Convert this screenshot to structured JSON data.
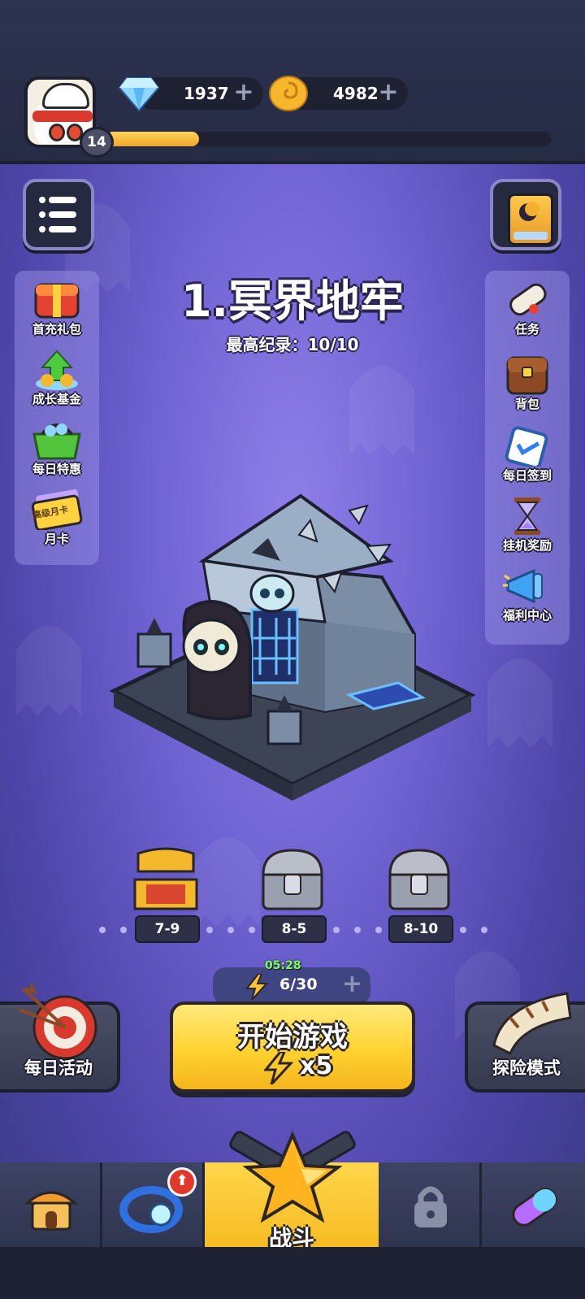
{
  "player": {
    "level": "14",
    "xp_fraction": 0.21
  },
  "currencies": {
    "diamonds": {
      "value": "1937",
      "plus": "+",
      "icon": "diamond-icon"
    },
    "gold": {
      "value": "4982",
      "plus": "+",
      "icon": "gold-coin-icon"
    }
  },
  "stage": {
    "title": "1.冥界地牢",
    "best_record": "最高纪录：10/10"
  },
  "left_menu": [
    {
      "label": "首充礼包",
      "icon": "gift-box-icon"
    },
    {
      "label": "成长基金",
      "icon": "growth-fund-icon"
    },
    {
      "label": "每日特惠",
      "icon": "shopping-basket-icon"
    },
    {
      "label": "月卡",
      "icon": "monthly-card-icon",
      "card_text": "高级月卡"
    }
  ],
  "right_menu": [
    {
      "label": "任务",
      "icon": "scroll-icon"
    },
    {
      "label": "背包",
      "icon": "backpack-icon"
    },
    {
      "label": "每日签到",
      "icon": "clipboard-check-icon"
    },
    {
      "label": "挂机奖励",
      "icon": "hourglass-icon"
    },
    {
      "label": "福利中心",
      "icon": "megaphone-icon"
    }
  ],
  "chests": [
    {
      "label": "7-9",
      "state": "opened",
      "color": "#f3b82c"
    },
    {
      "label": "8-5",
      "state": "locked",
      "color": "#9aa0ad"
    },
    {
      "label": "8-10",
      "state": "locked",
      "color": "#9aa0ad"
    }
  ],
  "energy": {
    "timer": "05:28",
    "count": "6/30",
    "plus": "+"
  },
  "start_button": {
    "label": "开始游戏",
    "cost": "x5"
  },
  "daily_activity": {
    "label": "每日活动"
  },
  "adventure_mode": {
    "label": "探险模式"
  },
  "bottom_nav": {
    "battle_label": "战斗",
    "ring_badge": "⬆",
    "active": "battle"
  },
  "colors": {
    "accent_yellow": "#ffd230",
    "background_purple": "#6f62d2",
    "topbar": "#2b3049"
  }
}
